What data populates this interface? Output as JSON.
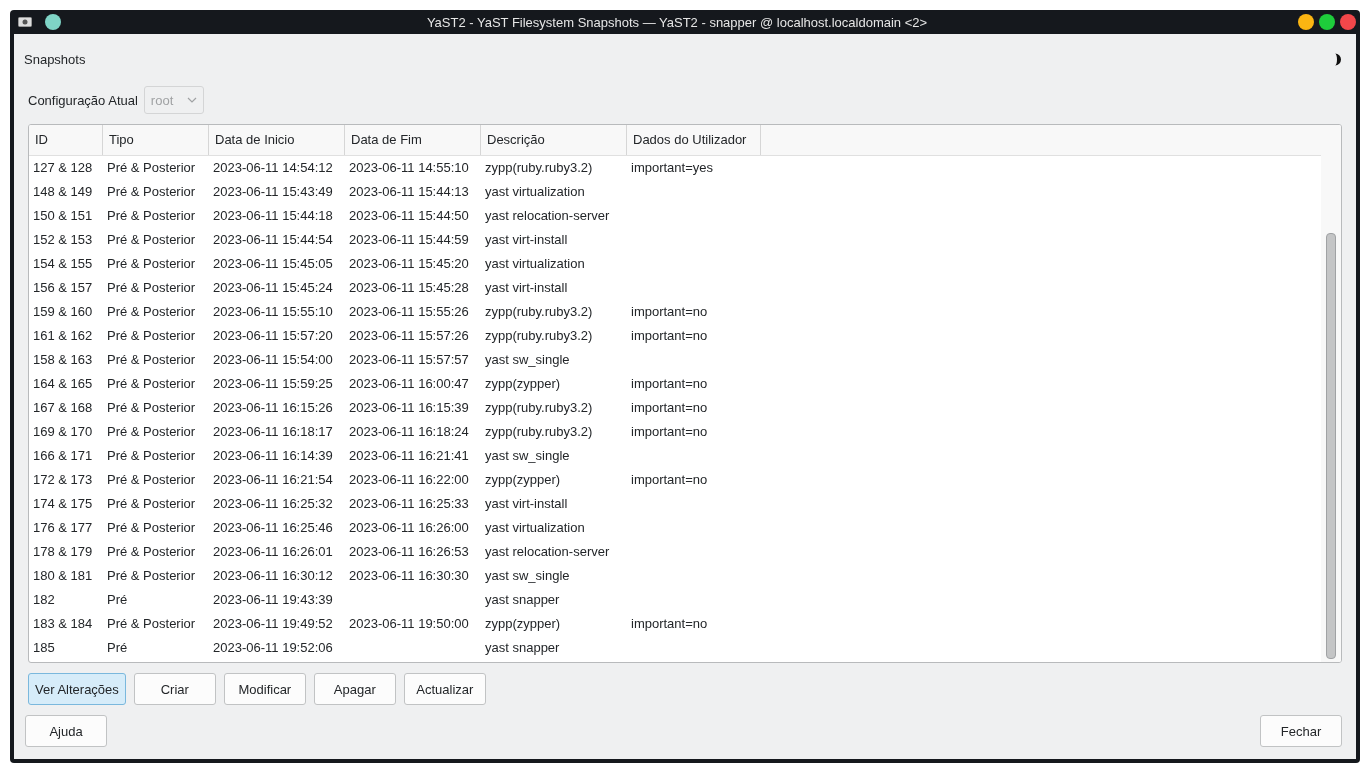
{
  "window": {
    "title": "YaST2 - YaST Filesystem Snapshots — YaST2 - snapper @ localhost.localdomain <2>"
  },
  "heading": "Snapshots",
  "config": {
    "label": "Configuração Atual",
    "value": "root",
    "disabled": true
  },
  "table": {
    "columns": [
      "ID",
      "Tipo",
      "Data de Inicio",
      "Data de Fim",
      "Descrição",
      "Dados do Utilizador"
    ],
    "rows": [
      [
        "127 & 128",
        "Pré & Posterior",
        "2023-06-11 14:54:12",
        "2023-06-11 14:55:10",
        "zypp(ruby.ruby3.2)",
        "important=yes"
      ],
      [
        "148 & 149",
        "Pré & Posterior",
        "2023-06-11 15:43:49",
        "2023-06-11 15:44:13",
        "yast virtualization",
        ""
      ],
      [
        "150 & 151",
        "Pré & Posterior",
        "2023-06-11 15:44:18",
        "2023-06-11 15:44:50",
        "yast relocation-server",
        ""
      ],
      [
        "152 & 153",
        "Pré & Posterior",
        "2023-06-11 15:44:54",
        "2023-06-11 15:44:59",
        "yast virt-install",
        ""
      ],
      [
        "154 & 155",
        "Pré & Posterior",
        "2023-06-11 15:45:05",
        "2023-06-11 15:45:20",
        "yast virtualization",
        ""
      ],
      [
        "156 & 157",
        "Pré & Posterior",
        "2023-06-11 15:45:24",
        "2023-06-11 15:45:28",
        "yast virt-install",
        ""
      ],
      [
        "159 & 160",
        "Pré & Posterior",
        "2023-06-11 15:55:10",
        "2023-06-11 15:55:26",
        "zypp(ruby.ruby3.2)",
        "important=no"
      ],
      [
        "161 & 162",
        "Pré & Posterior",
        "2023-06-11 15:57:20",
        "2023-06-11 15:57:26",
        "zypp(ruby.ruby3.2)",
        "important=no"
      ],
      [
        "158 & 163",
        "Pré & Posterior",
        "2023-06-11 15:54:00",
        "2023-06-11 15:57:57",
        "yast sw_single",
        ""
      ],
      [
        "164 & 165",
        "Pré & Posterior",
        "2023-06-11 15:59:25",
        "2023-06-11 16:00:47",
        "zypp(zypper)",
        "important=no"
      ],
      [
        "167 & 168",
        "Pré & Posterior",
        "2023-06-11 16:15:26",
        "2023-06-11 16:15:39",
        "zypp(ruby.ruby3.2)",
        "important=no"
      ],
      [
        "169 & 170",
        "Pré & Posterior",
        "2023-06-11 16:18:17",
        "2023-06-11 16:18:24",
        "zypp(ruby.ruby3.2)",
        "important=no"
      ],
      [
        "166 & 171",
        "Pré & Posterior",
        "2023-06-11 16:14:39",
        "2023-06-11 16:21:41",
        "yast sw_single",
        ""
      ],
      [
        "172 & 173",
        "Pré & Posterior",
        "2023-06-11 16:21:54",
        "2023-06-11 16:22:00",
        "zypp(zypper)",
        "important=no"
      ],
      [
        "174 & 175",
        "Pré & Posterior",
        "2023-06-11 16:25:32",
        "2023-06-11 16:25:33",
        "yast virt-install",
        ""
      ],
      [
        "176 & 177",
        "Pré & Posterior",
        "2023-06-11 16:25:46",
        "2023-06-11 16:26:00",
        "yast virtualization",
        ""
      ],
      [
        "178 & 179",
        "Pré & Posterior",
        "2023-06-11 16:26:01",
        "2023-06-11 16:26:53",
        "yast relocation-server",
        ""
      ],
      [
        "180 & 181",
        "Pré & Posterior",
        "2023-06-11 16:30:12",
        "2023-06-11 16:30:30",
        "yast sw_single",
        ""
      ],
      [
        "182",
        "Pré",
        "2023-06-11 19:43:39",
        "",
        "yast snapper",
        ""
      ],
      [
        "183 & 184",
        "Pré & Posterior",
        "2023-06-11 19:49:52",
        "2023-06-11 19:50:00",
        "zypp(zypper)",
        "important=no"
      ],
      [
        "185",
        "Pré",
        "2023-06-11 19:52:06",
        "",
        "yast snapper",
        ""
      ]
    ]
  },
  "actions": [
    {
      "label": "Ver Alterações",
      "focused": true
    },
    {
      "label": "Criar",
      "focused": false
    },
    {
      "label": "Modificar",
      "focused": false
    },
    {
      "label": "Apagar",
      "focused": false
    },
    {
      "label": "Actualizar",
      "focused": false
    }
  ],
  "footer": {
    "help": "Ajuda",
    "close": "Fechar"
  }
}
